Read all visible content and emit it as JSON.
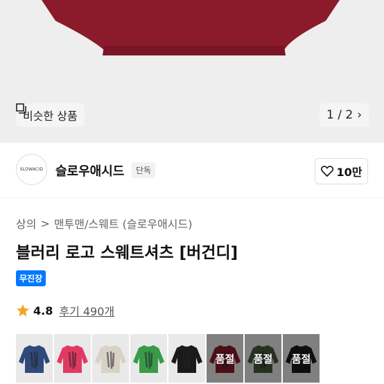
{
  "hero": {
    "similar_label": "비슷한 상품",
    "pager": "1 / 2"
  },
  "store": {
    "logo_text": "SLOWACID",
    "name": "슬로우애시드",
    "exclusive": "단독",
    "likes": "10만"
  },
  "breadcrumb": {
    "category": "상의",
    "separator": ">",
    "subcategory": "맨투맨/스웨트 (슬로우애시드)"
  },
  "product": {
    "title": "블러리 로고 스웨트셔츠 [버건디]",
    "badge": "무진장",
    "rating": "4.8",
    "reviews": "후기 490개"
  },
  "colors": {
    "accent": "#0078ff",
    "star": "#f5a623",
    "hero_shirt": "#8b1a2b"
  },
  "swatches": [
    {
      "color": "#2f4a7a",
      "sold_out": false,
      "label": ""
    },
    {
      "color": "#e03a63",
      "sold_out": false,
      "label": ""
    },
    {
      "color": "#d8d2c6",
      "sold_out": false,
      "label": ""
    },
    {
      "color": "#3a9a4a",
      "sold_out": false,
      "label": ""
    },
    {
      "color": "#1a1a1a",
      "sold_out": false,
      "label": ""
    },
    {
      "color": "#8b1a2b",
      "sold_out": true,
      "label": "품절"
    },
    {
      "color": "#4a5a3a",
      "sold_out": true,
      "label": "품절"
    },
    {
      "color": "#1a1a1a",
      "sold_out": true,
      "label": "품절"
    }
  ]
}
